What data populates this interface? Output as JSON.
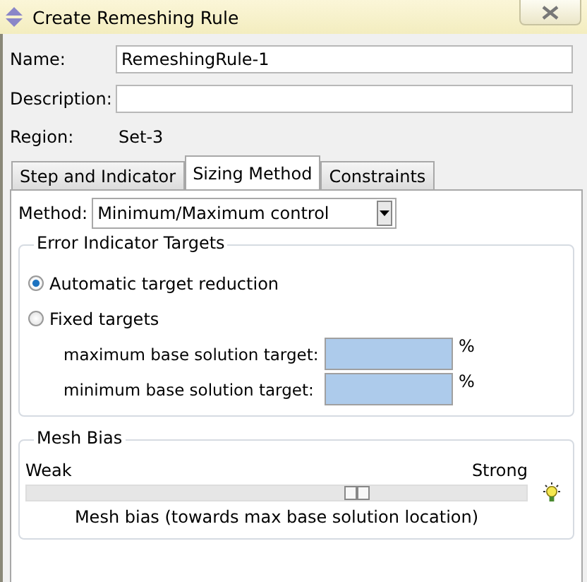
{
  "window": {
    "title": "Create Remeshing Rule"
  },
  "fields": [
    {
      "label": "Name:",
      "value": "RemeshingRule-1"
    },
    {
      "label": "Description:"
    }
  ],
  "region": {
    "label": "Region:",
    "value": "Set-3"
  },
  "tabs": [
    {
      "label": "Step and Indicator",
      "selected": false
    },
    {
      "label": "Sizing Method",
      "selected": true
    },
    {
      "label": "Constraints",
      "selected": false
    }
  ],
  "method": {
    "label": "Method:",
    "value": "Minimum/Maximum control"
  },
  "error_targets": {
    "title": "Error Indicator Targets",
    "options": [
      {
        "label": "Automatic target reduction",
        "selected": true
      },
      {
        "label": "Fixed targets",
        "selected": false
      }
    ],
    "inputs": [
      {
        "label": "maximum base solution target:",
        "unit": "%"
      },
      {
        "label": "minimum base solution target:",
        "unit": "%"
      }
    ]
  },
  "mesh_bias": {
    "title": "Mesh Bias",
    "min_label": "Weak",
    "max_label": "Strong",
    "level": 0.67,
    "caption": "Mesh bias (towards max base solution location)"
  }
}
